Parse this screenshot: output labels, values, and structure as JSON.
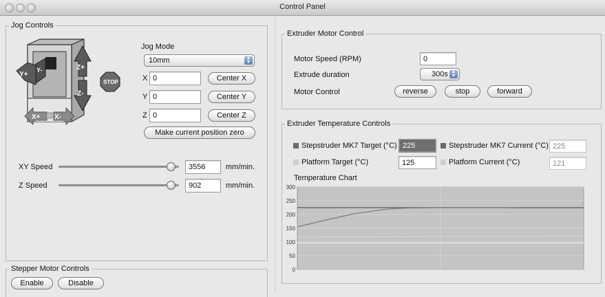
{
  "window": {
    "title": "Control Panel"
  },
  "jog": {
    "title": "Jog Controls",
    "mode_label": "Jog Mode",
    "mode_value": "10mm",
    "x_label": "X",
    "x_value": "0",
    "y_label": "Y",
    "y_value": "0",
    "z_label": "Z",
    "z_value": "0",
    "center_x": "Center X",
    "center_y": "Center Y",
    "center_z": "Center Z",
    "make_zero": "Make current position zero",
    "stop_label": "STOP",
    "yplus": "Y+",
    "yminus": "Y-",
    "zplus": "Z+",
    "zminus": "Z-",
    "xplus": "X+",
    "xminus": "X-",
    "xy_speed_label": "XY Speed",
    "xy_speed_value": "3556",
    "xy_speed_unit": "mm/min.",
    "xy_speed_fraction": 0.93,
    "z_speed_label": "Z Speed",
    "z_speed_value": "902",
    "z_speed_unit": "mm/min.",
    "z_speed_fraction": 0.93
  },
  "stepper": {
    "title": "Stepper Motor Controls",
    "enable": "Enable",
    "disable": "Disable"
  },
  "extruder_motor": {
    "title": "Extruder Motor Control",
    "speed_label": "Motor Speed (RPM)",
    "speed_value": "0",
    "duration_label": "Extrude duration",
    "duration_value": "300s",
    "control_label": "Motor Control",
    "reverse": "reverse",
    "stop": "stop",
    "forward": "forward"
  },
  "temperature": {
    "title": "Extruder Temperature Controls",
    "target_label": "Stepstruder MK7 Target (°C)",
    "target_value": "225",
    "current_label": "Stepstruder MK7 Current (°C)",
    "current_value": "225",
    "platform_target_label": "Platform Target (°C)",
    "platform_target_value": "125",
    "platform_current_label": "Platform Current (°C)",
    "platform_current_value": "121",
    "colors": {
      "extruder": "#6a6a6a",
      "platform": "#cfcfcf",
      "plot_bg": "#c4c4c4"
    }
  },
  "chart_data": {
    "type": "line",
    "title": "Temperature Chart",
    "ylim": [
      0,
      300
    ],
    "yticks": [
      0,
      50,
      100,
      150,
      200,
      250,
      300
    ],
    "grid": true,
    "series": [
      {
        "x": [
          0,
          0.1,
          0.2,
          0.3,
          0.4,
          0.5,
          0.6,
          0.7,
          0.8,
          0.9,
          1.0
        ],
        "values": [
          225,
          225,
          225,
          225,
          225,
          225,
          225,
          225,
          225,
          225,
          225
        ]
      },
      {
        "x": [
          0,
          0.1,
          0.2,
          0.3,
          0.35,
          0.4,
          0.5,
          0.6,
          0.7,
          0.8,
          0.9,
          1.0
        ],
        "values": [
          155,
          180,
          203,
          218,
          222,
          224,
          225,
          225,
          225,
          224,
          224,
          224
        ]
      },
      {
        "x": [
          0,
          1.0
        ],
        "values": [
          97,
          97
        ]
      },
      {
        "x": [
          0,
          0.5,
          1.0
        ],
        "values": [
          118,
          120,
          121
        ]
      }
    ]
  }
}
